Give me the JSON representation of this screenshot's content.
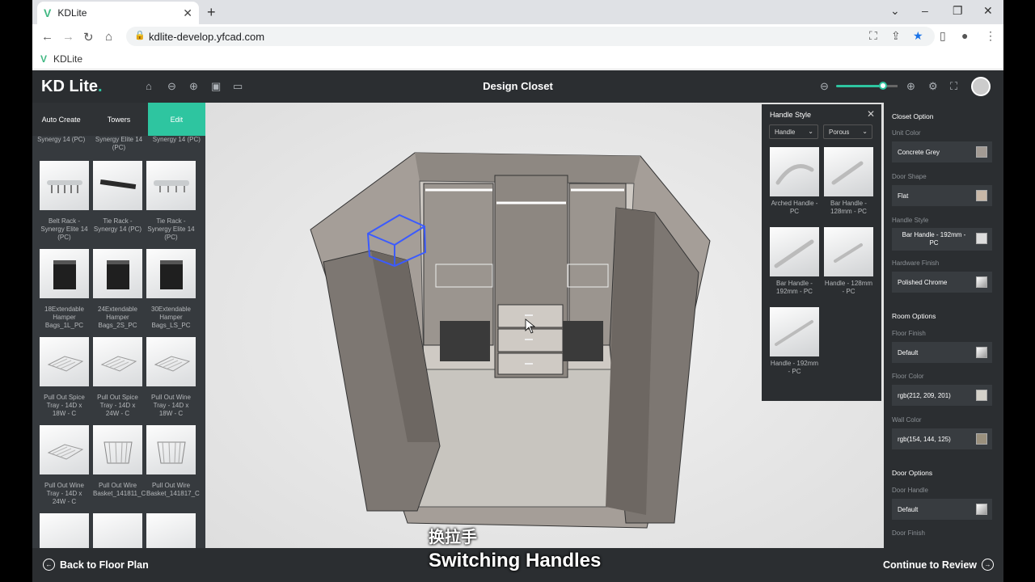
{
  "browser": {
    "tab_title": "KDLite",
    "url": "kdlite-develop.yfcad.com",
    "bookmark": "KDLite"
  },
  "app": {
    "brand": "KD Lite",
    "title": "Design Closet"
  },
  "left_panel": {
    "tabs": [
      "Auto Create",
      "Towers",
      "Edit"
    ],
    "top_labels": [
      "Synergy 14 (PC)",
      "Synergy Elite 14 (PC)",
      "Synergy 14 (PC)"
    ],
    "products": [
      [
        "Belt Rack - Synergy Elite 14 (PC)",
        "Tie Rack - Synergy 14 (PC)",
        "Tie Rack - Synergy Elite 14 (PC)"
      ],
      [
        "18Extendable Hamper Bags_1L_PC",
        "24Extendable Hamper Bags_2S_PC",
        "30Extendable Hamper Bags_LS_PC"
      ],
      [
        "Pull Out Spice Tray - 14D x 18W - C",
        "Pull Out Spice Tray - 14D x 24W - C",
        "Pull Out Wine Tray - 14D x 18W - C"
      ],
      [
        "Pull Out Wine Tray - 14D x 24W - C",
        "Pull Out Wire Basket_141811_C",
        "Pull Out Wire Basket_141817_C"
      ]
    ]
  },
  "handle_style": {
    "title": "Handle Style",
    "filter_type": "Handle",
    "filter_finish": "Porous",
    "items": [
      [
        "Arched Handle - PC",
        "Bar Handle - 128mm - PC"
      ],
      [
        "Bar Handle - 192mm - PC",
        "Handle - 128mm - PC"
      ],
      [
        "Handle - 192mm - PC"
      ]
    ]
  },
  "right_panel": {
    "closet_option": "Closet Option",
    "unit_color_label": "Unit Color",
    "unit_color": "Concrete Grey",
    "door_shape_label": "Door Shape",
    "door_shape": "Flat",
    "handle_style_label": "Handle Style",
    "handle_style": "Bar Handle - 192mm - PC",
    "hardware_finish_label": "Hardware Finish",
    "hardware_finish": "Polished Chrome",
    "room_options": "Room Options",
    "floor_finish_label": "Floor Finish",
    "floor_finish": "Default",
    "floor_color_label": "Floor Color",
    "floor_color": "rgb(212, 209, 201)",
    "wall_color_label": "Wall Color",
    "wall_color": "rgb(154, 144, 125)",
    "door_options": "Door Options",
    "door_handle_label": "Door Handle",
    "door_handle": "Default",
    "door_finish_label": "Door Finish"
  },
  "footer": {
    "back": "Back to Floor Plan",
    "next": "Continue to Review"
  },
  "captions": {
    "chinese": "换拉手",
    "english": "Switching Handles"
  },
  "colors": {
    "accent": "#2ec5a0",
    "concrete_grey": "#a39b94",
    "flat_door": "#c8b8a8",
    "floor": "#d4d1c9",
    "wall": "#9a907d"
  }
}
